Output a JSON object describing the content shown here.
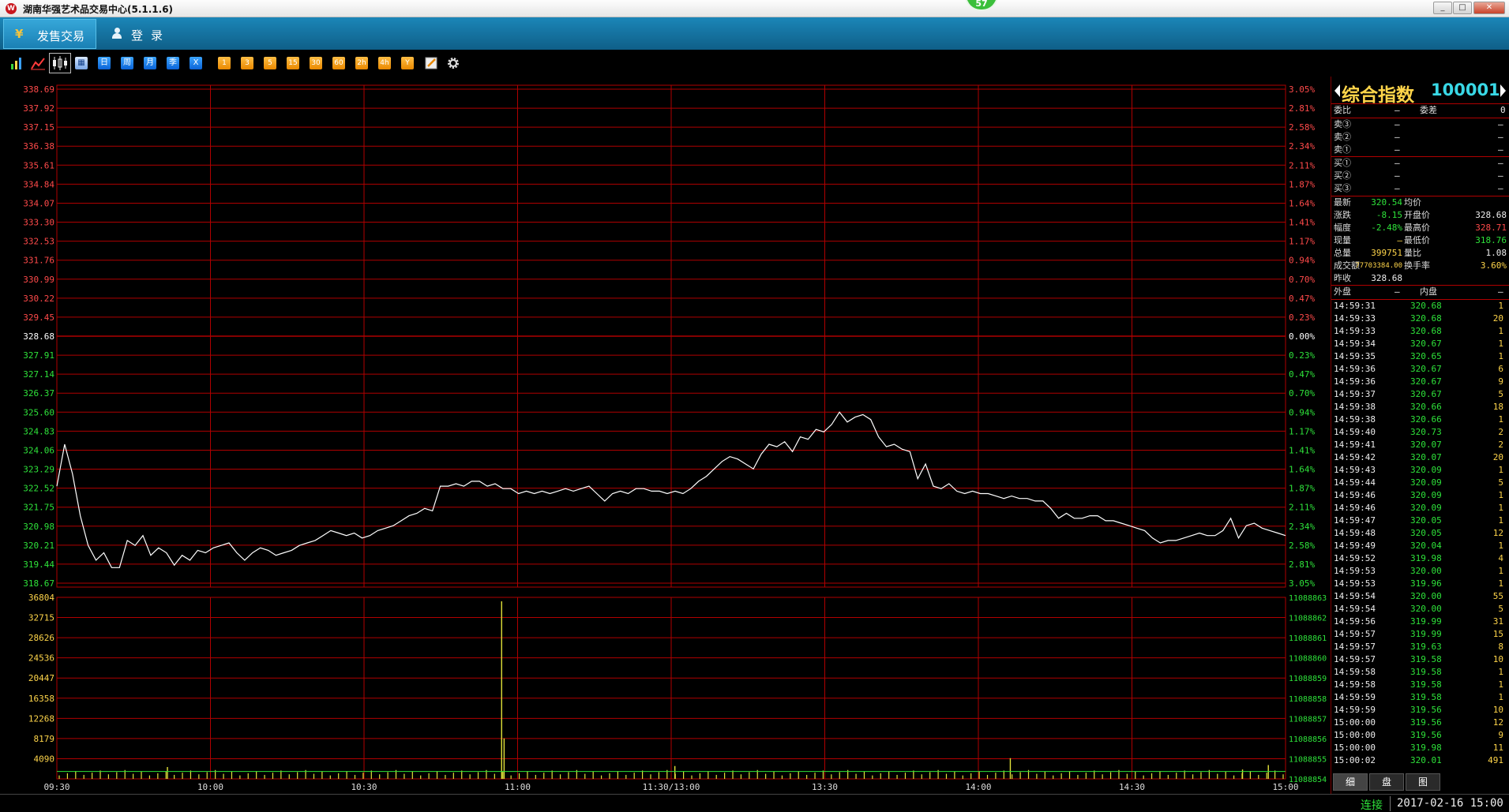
{
  "window": {
    "title": "湖南华强艺术品交易中心(5.1.1.6)",
    "notification_count": "57",
    "minimize_icon": "minimize-icon",
    "maximize_icon": "maximize-icon",
    "close_icon": "close-icon"
  },
  "menu": {
    "tabs": [
      {
        "label": "发售交易",
        "icon": "yuan-icon",
        "selected": true
      },
      {
        "label": "登录",
        "icon": "user-icon",
        "selected": false
      }
    ]
  },
  "toolbar": {
    "chart_buttons": [
      {
        "name": "bar-chart-icon"
      },
      {
        "name": "line-chart-icon"
      },
      {
        "name": "timeshare-chart-icon",
        "selected": true
      },
      {
        "name": "calendar-icon"
      }
    ],
    "period_buttons": [
      "日",
      "周",
      "月",
      "季",
      "X"
    ],
    "minute_buttons": [
      "1",
      "3",
      "5",
      "15",
      "30",
      "60",
      "2h",
      "4h",
      "Y"
    ],
    "extra_icons": [
      "draw-tool-icon",
      "settings-gear-icon"
    ]
  },
  "chart_data": [
    {
      "type": "line",
      "title": "",
      "prev_close": 328.68,
      "ylim": [
        318.67,
        338.69
      ],
      "price_ticks": [
        "338.69",
        "337.92",
        "337.15",
        "336.38",
        "335.61",
        "334.84",
        "334.07",
        "333.30",
        "332.53",
        "331.76",
        "330.99",
        "330.22",
        "329.45",
        "328.68",
        "327.91",
        "327.14",
        "326.37",
        "325.60",
        "324.83",
        "324.06",
        "323.29",
        "322.52",
        "321.75",
        "320.98",
        "320.21",
        "319.44",
        "318.67"
      ],
      "pct_ticks": [
        "3.05%",
        "2.81%",
        "2.58%",
        "2.34%",
        "2.11%",
        "1.87%",
        "1.64%",
        "1.41%",
        "1.17%",
        "0.94%",
        "0.70%",
        "0.47%",
        "0.23%",
        "0.00%",
        "0.23%",
        "0.47%",
        "0.70%",
        "0.94%",
        "1.17%",
        "1.41%",
        "1.64%",
        "1.87%",
        "2.11%",
        "2.34%",
        "2.58%",
        "2.81%",
        "3.05%"
      ],
      "x_labels": [
        "09:30",
        "10:00",
        "10:30",
        "11:00",
        "11:30/13:00",
        "13:30",
        "14:00",
        "14:30",
        "15:00"
      ],
      "series": [
        {
          "values": [
            322.6,
            324.3,
            323.1,
            321.4,
            320.2,
            319.6,
            319.9,
            319.3,
            319.3,
            320.4,
            320.2,
            320.6,
            319.8,
            320.1,
            319.9,
            319.4,
            319.8,
            319.6,
            320.0,
            319.9,
            320.1,
            320.2,
            320.3,
            319.9,
            319.6,
            319.9,
            320.1,
            320.0,
            319.8,
            319.9,
            320.0,
            320.2,
            320.3,
            320.4,
            320.6,
            320.8,
            320.7,
            320.6,
            320.7,
            320.5,
            320.6,
            320.8,
            320.9,
            321.0,
            321.2,
            321.4,
            321.5,
            321.7,
            321.6,
            322.6,
            322.6,
            322.7,
            322.6,
            322.8,
            322.8,
            322.6,
            322.7,
            322.5,
            322.5,
            322.3,
            322.4,
            322.3,
            322.4,
            322.3,
            322.4,
            322.5,
            322.4,
            322.5,
            322.6,
            322.3,
            322.0,
            322.3,
            322.4,
            322.3,
            322.5,
            322.5,
            322.4,
            322.4,
            322.3,
            322.4,
            322.3,
            322.5,
            322.8,
            323.0,
            323.3,
            323.6,
            323.8,
            323.7,
            323.5,
            323.3,
            323.9,
            324.3,
            324.2,
            324.4,
            324.0,
            324.6,
            324.5,
            324.9,
            324.8,
            325.1,
            325.6,
            325.2,
            325.4,
            325.5,
            325.3,
            324.6,
            324.2,
            324.3,
            324.1,
            324.0,
            322.9,
            323.5,
            322.6,
            322.5,
            322.7,
            322.4,
            322.3,
            322.4,
            322.3,
            322.3,
            322.2,
            322.1,
            322.2,
            322.1,
            322.1,
            322.0,
            322.0,
            321.7,
            321.3,
            321.5,
            321.3,
            321.3,
            321.4,
            321.4,
            321.2,
            321.2,
            321.1,
            321.0,
            320.9,
            320.8,
            320.5,
            320.3,
            320.4,
            320.4,
            320.5,
            320.6,
            320.7,
            320.6,
            320.6,
            320.8,
            321.3,
            320.5,
            321.0,
            321.1,
            320.9,
            320.8,
            320.7,
            320.6
          ],
          "color": "#ffffff"
        }
      ],
      "grid": true
    },
    {
      "type": "bar",
      "title": "",
      "ylim": [
        0,
        36804
      ],
      "y_ticks": [
        "36804",
        "32715",
        "28626",
        "24536",
        "20447",
        "16358",
        "12268",
        "8179",
        "4090"
      ],
      "right_ticks": [
        "11088863",
        "11088862",
        "11088861",
        "11088860",
        "11088859",
        "11088858",
        "11088857",
        "11088856",
        "11088855",
        "11088854"
      ],
      "average_line": 1500,
      "spikes": [
        {
          "t": 0.09,
          "value": 2400
        },
        {
          "t": 0.362,
          "value": 36000
        },
        {
          "t": 0.364,
          "value": 8200
        },
        {
          "t": 0.503,
          "value": 2600
        },
        {
          "t": 0.776,
          "value": 4200
        },
        {
          "t": 0.965,
          "value": 1900
        },
        {
          "t": 0.986,
          "value": 2800
        }
      ]
    }
  ],
  "quote_panel": {
    "name": "综合指数",
    "code": "100001",
    "weibi_label": "委比",
    "weibi_value": "—",
    "weicha_label": "委差",
    "weicha_value": "0",
    "sell_rows": [
      {
        "label": "卖③",
        "price": "—",
        "qty": "—"
      },
      {
        "label": "卖②",
        "price": "—",
        "qty": "—"
      },
      {
        "label": "卖①",
        "price": "—",
        "qty": "—"
      }
    ],
    "buy_rows": [
      {
        "label": "买①",
        "price": "—",
        "qty": "—"
      },
      {
        "label": "买②",
        "price": "—",
        "qty": "—"
      },
      {
        "label": "买③",
        "price": "—",
        "qty": "—"
      }
    ],
    "stats": [
      {
        "l1": "最新",
        "v1": "320.54",
        "l2": "均价",
        "v2": ""
      },
      {
        "l1": "涨跌",
        "v1": "-8.15",
        "l2": "开盘价",
        "v2": "328.68"
      },
      {
        "l1": "幅度",
        "v1": "-2.48%",
        "l2": "最高价",
        "v2": "328.71"
      },
      {
        "l1": "现量",
        "v1": "—",
        "l2": "最低价",
        "v2": "318.76"
      },
      {
        "l1": "总量",
        "v1": "399751",
        "l2": "量比",
        "v2": "1.08"
      },
      {
        "l1": "成交额",
        "v1": "77703384.00",
        "l2": "换手率",
        "v2": "3.60%"
      },
      {
        "l1": "昨收",
        "v1": "328.68",
        "l2": "",
        "v2": ""
      }
    ],
    "outer_label": "外盘",
    "outer_value": "—",
    "inner_label": "内盘",
    "inner_value": "—",
    "ticks": [
      {
        "time": "14:59:31",
        "price": "320.68",
        "qty": "1"
      },
      {
        "time": "14:59:33",
        "price": "320.68",
        "qty": "20"
      },
      {
        "time": "14:59:33",
        "price": "320.68",
        "qty": "1"
      },
      {
        "time": "14:59:34",
        "price": "320.67",
        "qty": "1"
      },
      {
        "time": "14:59:35",
        "price": "320.65",
        "qty": "1"
      },
      {
        "time": "14:59:36",
        "price": "320.67",
        "qty": "6"
      },
      {
        "time": "14:59:36",
        "price": "320.67",
        "qty": "9"
      },
      {
        "time": "14:59:37",
        "price": "320.67",
        "qty": "5"
      },
      {
        "time": "14:59:38",
        "price": "320.66",
        "qty": "18"
      },
      {
        "time": "14:59:38",
        "price": "320.66",
        "qty": "1"
      },
      {
        "time": "14:59:40",
        "price": "320.73",
        "qty": "2"
      },
      {
        "time": "14:59:41",
        "price": "320.07",
        "qty": "2"
      },
      {
        "time": "14:59:42",
        "price": "320.07",
        "qty": "20"
      },
      {
        "time": "14:59:43",
        "price": "320.09",
        "qty": "1"
      },
      {
        "time": "14:59:44",
        "price": "320.09",
        "qty": "5"
      },
      {
        "time": "14:59:46",
        "price": "320.09",
        "qty": "1"
      },
      {
        "time": "14:59:46",
        "price": "320.09",
        "qty": "1"
      },
      {
        "time": "14:59:47",
        "price": "320.05",
        "qty": "1"
      },
      {
        "time": "14:59:48",
        "price": "320.05",
        "qty": "12"
      },
      {
        "time": "14:59:49",
        "price": "320.04",
        "qty": "1"
      },
      {
        "time": "14:59:52",
        "price": "319.98",
        "qty": "4"
      },
      {
        "time": "14:59:53",
        "price": "320.00",
        "qty": "1"
      },
      {
        "time": "14:59:53",
        "price": "319.96",
        "qty": "1"
      },
      {
        "time": "14:59:54",
        "price": "320.00",
        "qty": "55"
      },
      {
        "time": "14:59:54",
        "price": "320.00",
        "qty": "5"
      },
      {
        "time": "14:59:56",
        "price": "319.99",
        "qty": "31"
      },
      {
        "time": "14:59:57",
        "price": "319.99",
        "qty": "15"
      },
      {
        "time": "14:59:57",
        "price": "319.63",
        "qty": "8"
      },
      {
        "time": "14:59:57",
        "price": "319.58",
        "qty": "10"
      },
      {
        "time": "14:59:58",
        "price": "319.58",
        "qty": "1"
      },
      {
        "time": "14:59:58",
        "price": "319.58",
        "qty": "1"
      },
      {
        "time": "14:59:59",
        "price": "319.58",
        "qty": "1"
      },
      {
        "time": "14:59:59",
        "price": "319.56",
        "qty": "10"
      },
      {
        "time": "15:00:00",
        "price": "319.56",
        "qty": "12"
      },
      {
        "time": "15:00:00",
        "price": "319.56",
        "qty": "9"
      },
      {
        "time": "15:00:00",
        "price": "319.98",
        "qty": "11"
      },
      {
        "time": "15:00:02",
        "price": "320.01",
        "qty": "491"
      }
    ],
    "bottom_tabs": [
      "细",
      "盘",
      "图"
    ]
  },
  "status": {
    "connection": "连接",
    "datetime": "2017-02-16 15:00"
  },
  "colors": {
    "grid": "#b00000",
    "up": "#ff4a4a",
    "down": "#2ee23a",
    "line": "#ffffff",
    "volume": "#e3e33a",
    "avg": "#2ee23a"
  }
}
